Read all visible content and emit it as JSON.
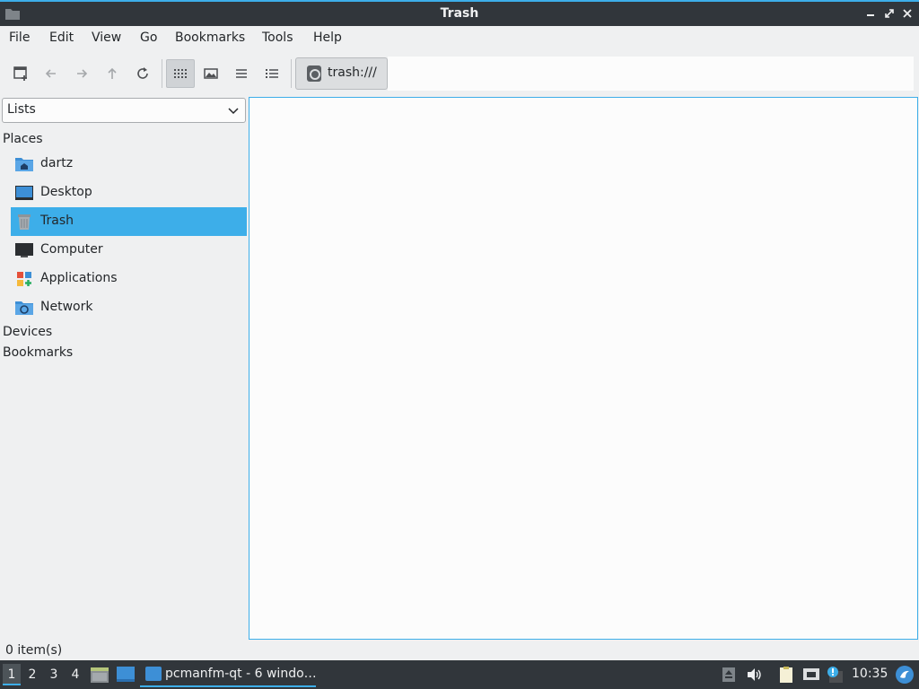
{
  "window": {
    "title": "Trash"
  },
  "menu": [
    "File",
    "Edit",
    "View",
    "Go",
    "Bookmarks",
    "Tools",
    "Help"
  ],
  "toolbar": {
    "buttons": [
      "new-tab-icon",
      "back-arrow-icon",
      "forward-arrow-icon",
      "up-arrow-icon",
      "reload-icon",
      "icon-view-icon",
      "thumbnail-view-icon",
      "compact-view-icon",
      "detailed-list-icon"
    ]
  },
  "path": {
    "label": "trash:///"
  },
  "sidebar": {
    "selector": "Lists",
    "sections": {
      "places": "Places",
      "devices": "Devices",
      "bookmarks": "Bookmarks"
    },
    "places": [
      {
        "label": "dartz",
        "icon": "home-folder-icon"
      },
      {
        "label": "Desktop",
        "icon": "desktop-icon"
      },
      {
        "label": "Trash",
        "icon": "trash-icon",
        "selected": true
      },
      {
        "label": "Computer",
        "icon": "computer-icon"
      },
      {
        "label": "Applications",
        "icon": "applications-icon"
      },
      {
        "label": "Network",
        "icon": "network-folder-icon"
      }
    ]
  },
  "status": {
    "text": "0 item(s)"
  },
  "taskbar": {
    "workspaces": [
      "1",
      "2",
      "3",
      "4"
    ],
    "active_workspace": "1",
    "task": "pcmanfm-qt - 6 windo…",
    "clock": "10:35"
  },
  "colors": {
    "accent": "#3daee9",
    "titlebar": "#31363b",
    "background": "#eff0f1"
  }
}
